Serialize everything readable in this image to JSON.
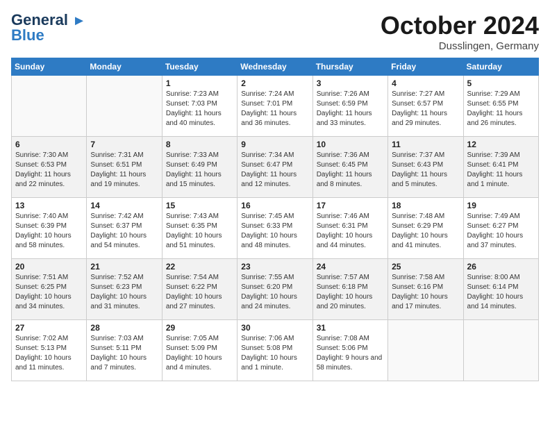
{
  "header": {
    "logo_line1": "General",
    "logo_line2": "Blue",
    "month_title": "October 2024",
    "location": "Dusslingen, Germany"
  },
  "weekdays": [
    "Sunday",
    "Monday",
    "Tuesday",
    "Wednesday",
    "Thursday",
    "Friday",
    "Saturday"
  ],
  "weeks": [
    [
      {
        "day": "",
        "sunrise": "",
        "sunset": "",
        "daylight": ""
      },
      {
        "day": "",
        "sunrise": "",
        "sunset": "",
        "daylight": ""
      },
      {
        "day": "1",
        "sunrise": "Sunrise: 7:23 AM",
        "sunset": "Sunset: 7:03 PM",
        "daylight": "Daylight: 11 hours and 40 minutes."
      },
      {
        "day": "2",
        "sunrise": "Sunrise: 7:24 AM",
        "sunset": "Sunset: 7:01 PM",
        "daylight": "Daylight: 11 hours and 36 minutes."
      },
      {
        "day": "3",
        "sunrise": "Sunrise: 7:26 AM",
        "sunset": "Sunset: 6:59 PM",
        "daylight": "Daylight: 11 hours and 33 minutes."
      },
      {
        "day": "4",
        "sunrise": "Sunrise: 7:27 AM",
        "sunset": "Sunset: 6:57 PM",
        "daylight": "Daylight: 11 hours and 29 minutes."
      },
      {
        "day": "5",
        "sunrise": "Sunrise: 7:29 AM",
        "sunset": "Sunset: 6:55 PM",
        "daylight": "Daylight: 11 hours and 26 minutes."
      }
    ],
    [
      {
        "day": "6",
        "sunrise": "Sunrise: 7:30 AM",
        "sunset": "Sunset: 6:53 PM",
        "daylight": "Daylight: 11 hours and 22 minutes."
      },
      {
        "day": "7",
        "sunrise": "Sunrise: 7:31 AM",
        "sunset": "Sunset: 6:51 PM",
        "daylight": "Daylight: 11 hours and 19 minutes."
      },
      {
        "day": "8",
        "sunrise": "Sunrise: 7:33 AM",
        "sunset": "Sunset: 6:49 PM",
        "daylight": "Daylight: 11 hours and 15 minutes."
      },
      {
        "day": "9",
        "sunrise": "Sunrise: 7:34 AM",
        "sunset": "Sunset: 6:47 PM",
        "daylight": "Daylight: 11 hours and 12 minutes."
      },
      {
        "day": "10",
        "sunrise": "Sunrise: 7:36 AM",
        "sunset": "Sunset: 6:45 PM",
        "daylight": "Daylight: 11 hours and 8 minutes."
      },
      {
        "day": "11",
        "sunrise": "Sunrise: 7:37 AM",
        "sunset": "Sunset: 6:43 PM",
        "daylight": "Daylight: 11 hours and 5 minutes."
      },
      {
        "day": "12",
        "sunrise": "Sunrise: 7:39 AM",
        "sunset": "Sunset: 6:41 PM",
        "daylight": "Daylight: 11 hours and 1 minute."
      }
    ],
    [
      {
        "day": "13",
        "sunrise": "Sunrise: 7:40 AM",
        "sunset": "Sunset: 6:39 PM",
        "daylight": "Daylight: 10 hours and 58 minutes."
      },
      {
        "day": "14",
        "sunrise": "Sunrise: 7:42 AM",
        "sunset": "Sunset: 6:37 PM",
        "daylight": "Daylight: 10 hours and 54 minutes."
      },
      {
        "day": "15",
        "sunrise": "Sunrise: 7:43 AM",
        "sunset": "Sunset: 6:35 PM",
        "daylight": "Daylight: 10 hours and 51 minutes."
      },
      {
        "day": "16",
        "sunrise": "Sunrise: 7:45 AM",
        "sunset": "Sunset: 6:33 PM",
        "daylight": "Daylight: 10 hours and 48 minutes."
      },
      {
        "day": "17",
        "sunrise": "Sunrise: 7:46 AM",
        "sunset": "Sunset: 6:31 PM",
        "daylight": "Daylight: 10 hours and 44 minutes."
      },
      {
        "day": "18",
        "sunrise": "Sunrise: 7:48 AM",
        "sunset": "Sunset: 6:29 PM",
        "daylight": "Daylight: 10 hours and 41 minutes."
      },
      {
        "day": "19",
        "sunrise": "Sunrise: 7:49 AM",
        "sunset": "Sunset: 6:27 PM",
        "daylight": "Daylight: 10 hours and 37 minutes."
      }
    ],
    [
      {
        "day": "20",
        "sunrise": "Sunrise: 7:51 AM",
        "sunset": "Sunset: 6:25 PM",
        "daylight": "Daylight: 10 hours and 34 minutes."
      },
      {
        "day": "21",
        "sunrise": "Sunrise: 7:52 AM",
        "sunset": "Sunset: 6:23 PM",
        "daylight": "Daylight: 10 hours and 31 minutes."
      },
      {
        "day": "22",
        "sunrise": "Sunrise: 7:54 AM",
        "sunset": "Sunset: 6:22 PM",
        "daylight": "Daylight: 10 hours and 27 minutes."
      },
      {
        "day": "23",
        "sunrise": "Sunrise: 7:55 AM",
        "sunset": "Sunset: 6:20 PM",
        "daylight": "Daylight: 10 hours and 24 minutes."
      },
      {
        "day": "24",
        "sunrise": "Sunrise: 7:57 AM",
        "sunset": "Sunset: 6:18 PM",
        "daylight": "Daylight: 10 hours and 20 minutes."
      },
      {
        "day": "25",
        "sunrise": "Sunrise: 7:58 AM",
        "sunset": "Sunset: 6:16 PM",
        "daylight": "Daylight: 10 hours and 17 minutes."
      },
      {
        "day": "26",
        "sunrise": "Sunrise: 8:00 AM",
        "sunset": "Sunset: 6:14 PM",
        "daylight": "Daylight: 10 hours and 14 minutes."
      }
    ],
    [
      {
        "day": "27",
        "sunrise": "Sunrise: 7:02 AM",
        "sunset": "Sunset: 5:13 PM",
        "daylight": "Daylight: 10 hours and 11 minutes."
      },
      {
        "day": "28",
        "sunrise": "Sunrise: 7:03 AM",
        "sunset": "Sunset: 5:11 PM",
        "daylight": "Daylight: 10 hours and 7 minutes."
      },
      {
        "day": "29",
        "sunrise": "Sunrise: 7:05 AM",
        "sunset": "Sunset: 5:09 PM",
        "daylight": "Daylight: 10 hours and 4 minutes."
      },
      {
        "day": "30",
        "sunrise": "Sunrise: 7:06 AM",
        "sunset": "Sunset: 5:08 PM",
        "daylight": "Daylight: 10 hours and 1 minute."
      },
      {
        "day": "31",
        "sunrise": "Sunrise: 7:08 AM",
        "sunset": "Sunset: 5:06 PM",
        "daylight": "Daylight: 9 hours and 58 minutes."
      },
      {
        "day": "",
        "sunrise": "",
        "sunset": "",
        "daylight": ""
      },
      {
        "day": "",
        "sunrise": "",
        "sunset": "",
        "daylight": ""
      }
    ]
  ]
}
